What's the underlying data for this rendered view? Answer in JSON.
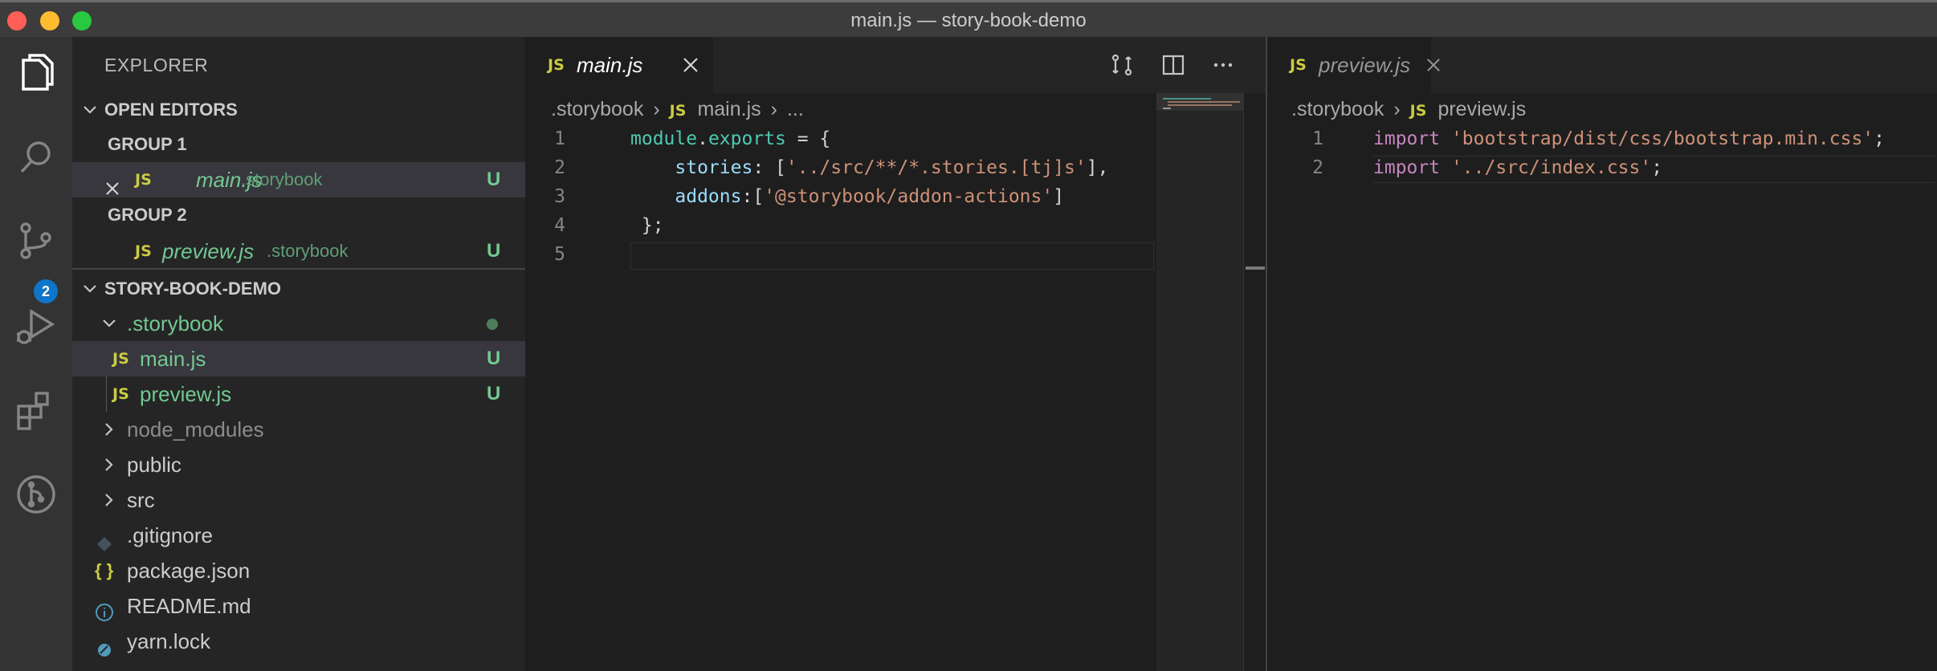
{
  "window": {
    "title": "main.js — story-book-demo"
  },
  "activity_bar": {
    "scm_badge": "2"
  },
  "explorer": {
    "title": "EXPLORER",
    "open_editors": {
      "label": "OPEN EDITORS",
      "group1_label": "GROUP 1",
      "group1_file": "main.js",
      "group1_dir": ".storybook",
      "group1_status": "U",
      "group2_label": "GROUP 2",
      "group2_file": "preview.js",
      "group2_dir": ".storybook",
      "group2_status": "U"
    },
    "project": {
      "label": "STORY-BOOK-DEMO",
      "storybook_folder": ".storybook",
      "main_js": "main.js",
      "main_js_status": "U",
      "preview_js": "preview.js",
      "preview_js_status": "U",
      "node_modules": "node_modules",
      "public": "public",
      "src": "src",
      "gitignore": ".gitignore",
      "package_json": "package.json",
      "package_json_icon": "{ }",
      "readme": "README.md",
      "yarn_lock": "yarn.lock"
    },
    "js_icon": "JS"
  },
  "editor_left": {
    "tab_label": "main.js",
    "breadcrumb": [
      ".storybook",
      "main.js",
      "..."
    ],
    "line_numbers": [
      "1",
      "2",
      "3",
      "4",
      "5"
    ],
    "code": {
      "l1_a": "module",
      "l1_b": ".",
      "l1_c": "exports",
      "l1_d": " = {",
      "l2_indent": "    ",
      "l2_key": "stories",
      "l2_colon": ": [",
      "l2_str": "'../src/**/*.stories.[tj]s'",
      "l2_end": "],",
      "l3_indent": "    ",
      "l3_key": "addons",
      "l3_colon": ":[",
      "l3_str": "'@storybook/addon-actions'",
      "l3_end": "]",
      "l4": " };"
    }
  },
  "editor_right": {
    "tab_label": "preview.js",
    "breadcrumb": [
      ".storybook",
      "preview.js"
    ],
    "line_numbers": [
      "1",
      "2"
    ],
    "code": {
      "l1_kw": "import",
      "l1_str": "'bootstrap/dist/css/bootstrap.min.css'",
      "l1_end": ";",
      "l2_kw": "import",
      "l2_str": "'../src/index.css'",
      "l2_end": ";"
    }
  },
  "colors": {
    "accent_blue": "#0e75c9",
    "untracked_green": "#73c991",
    "js_yellow": "#cbcb41"
  }
}
